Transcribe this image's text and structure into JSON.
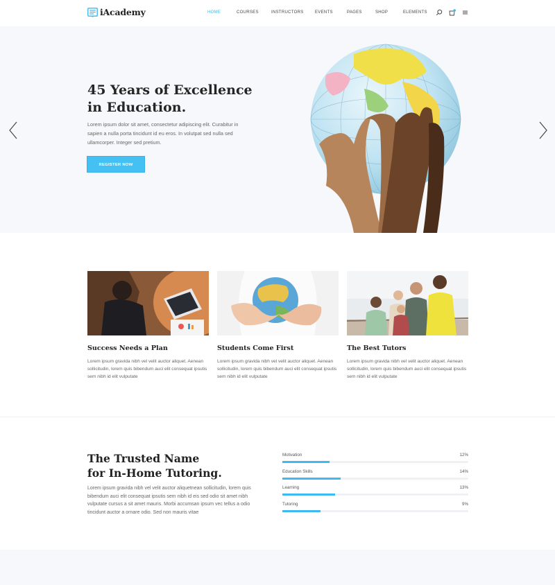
{
  "brand": {
    "name": "iAcademy",
    "accent": "#44c0f3"
  },
  "nav": {
    "items": [
      {
        "label": "Home",
        "active": true
      },
      {
        "label": "Courses",
        "active": false
      },
      {
        "label": "Instructors",
        "active": false
      },
      {
        "label": "Events",
        "active": false
      },
      {
        "label": "Pages",
        "active": false
      },
      {
        "label": "Shop",
        "active": false
      },
      {
        "label": "Elements",
        "active": false
      }
    ],
    "cart_count": "0",
    "icons": [
      "search-icon",
      "cart-icon",
      "menu-icon"
    ]
  },
  "hero": {
    "title_line1": "45 Years of Excellence",
    "title_line2": "in Education.",
    "text": "Lorem ipsum dolor sit amet, consectetur adipiscing elit. Curabitur in sapien a nulla porta tincidunt id eu eros. In volutpat sed nulla sed ullamcorper. Integer sed pretium.",
    "button_label": "REGISTER NOW",
    "prev_icon": "chevron-left-icon",
    "next_icon": "chevron-right-icon"
  },
  "features": [
    {
      "title": "Success Needs a Plan",
      "text": "Lorem ipsum gravida nibh vel velit auctor aliquet. Aenean sollicitudin, lorem quis bibendum auci elit consequat ipsutis sem nibh id elit vulputate"
    },
    {
      "title": "Students Come First",
      "text": "Lorem ipsum gravida nibh vel velit auctor aliquet. Aenean sollicitudin, lorem quis bibendum auci elit consequat ipsutis sem nibh id elit vulputate"
    },
    {
      "title": "The Best Tutors",
      "text": "Lorem ipsum gravida nibh vel velit auctor aliquet. Aenean sollicitudin, lorem quis bibendum auci elit consequat ipsutis sem nibh id elit vulputate"
    }
  ],
  "trusted": {
    "title_line1": "The Trusted Name",
    "title_line2": "for In-Home Tutoring.",
    "text": "Lorem ipsum gravida nibh vel velit auctor aliquetnean sollicitudin, lorem quis bibendum auci elit consequat ipsutis sem nibh id eis sed odio sit amet nibh vulputate cursus a sit amet mauris. Morbi accumsan ipsum vec tellus a odio tincidunt auctor a ornare odio. Sed non mauris vitae",
    "skills": [
      {
        "label": "Motivation",
        "value": "12%",
        "fill": 0.255
      },
      {
        "label": "Education Skills",
        "value": "14%",
        "fill": 0.315
      },
      {
        "label": "Learning",
        "value": "13%",
        "fill": 0.285
      },
      {
        "label": "Tutoring",
        "value": "9%",
        "fill": 0.205
      }
    ]
  }
}
